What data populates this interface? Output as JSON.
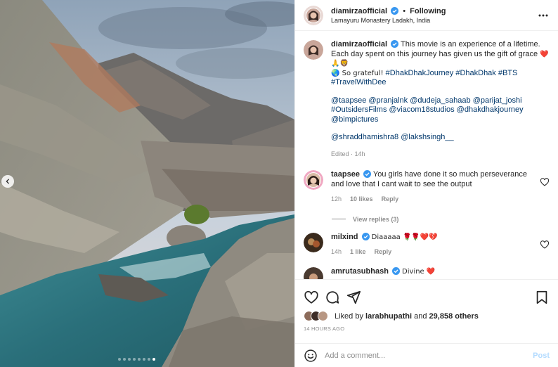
{
  "post": {
    "username": "diamirzaofficial",
    "separator": "•",
    "follow_status": "Following",
    "location": "Lamayuru Monastery Ladakh, India"
  },
  "caption": {
    "username": "diamirzaofficial",
    "text": "This movie is an experience of a lifetime. Each day spent on this journey has given us the gift of grace",
    "emoji1": "❤️🙏🦁",
    "line2_prefix": "🌏 So grateful!",
    "hashtags": "#DhakDhakJourney #DhakDhak #BTS #TravelWithDee",
    "mentions_block": "@taapsee @pranjalnk @dudeja_sahaab @parijat_joshi #OutsidersFilms @viacom18studios @dhakdhakjourney @bimpictures",
    "mentions_block2": "@shraddhamishra8 @lakshsingh__",
    "edited": "Edited · 14h"
  },
  "comments": [
    {
      "username": "taapsee",
      "text": "You girls have done it so much perseverance and love that I cant wait to see the output",
      "time": "12h",
      "likes": "10 likes",
      "reply": "Reply",
      "view_replies": "View replies (3)"
    },
    {
      "username": "milxind",
      "text": "Diaaaaa 🌹🌹❤️💔",
      "time": "14h",
      "likes": "1 like",
      "reply": "Reply"
    },
    {
      "username": "amrutasubhash",
      "text": "Divine ❤️"
    }
  ],
  "likes": {
    "prefix": "Liked by",
    "user": "larabhupathi",
    "and": "and",
    "others": "29,858 others"
  },
  "time_ago": "14 HOURS AGO",
  "composer": {
    "placeholder": "Add a comment...",
    "post_label": "Post"
  },
  "carousel": {
    "count": 8,
    "active_index": 7
  },
  "colors": {
    "verified": "#3897f0",
    "link": "#00376b",
    "muted": "#8e8e8e",
    "post": "#b3dbff",
    "heart": "#ed1c24"
  },
  "icons": [
    "chevron-left-icon",
    "more-icon",
    "verified-icon",
    "heart-icon",
    "comment-icon",
    "share-icon",
    "bookmark-icon",
    "emoji-icon"
  ]
}
